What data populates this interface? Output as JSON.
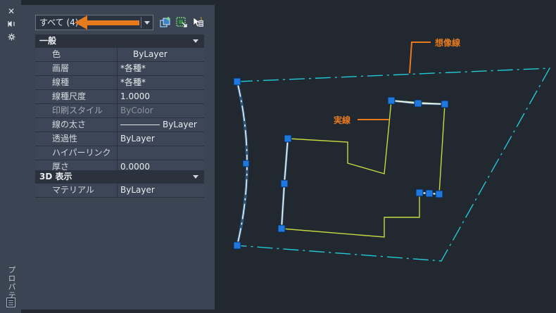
{
  "sidebar": {
    "close_icon": "close-icon",
    "pin_icon": "pin-icon",
    "settings_icon": "gear-icon",
    "vertical_title": "プロパティ",
    "bottom_icon": "properties-icon"
  },
  "selector": {
    "value": "すべて (4)",
    "toolbar_icons": [
      "quick-select-icon",
      "select-objects-icon",
      "toggle-pickadd-icon"
    ]
  },
  "sections": {
    "general": {
      "title": "一般",
      "rows": [
        {
          "label": "色",
          "value": "ByLayer",
          "has_swatch": true
        },
        {
          "label": "画層",
          "value": "*各種*"
        },
        {
          "label": "線種",
          "value": "*各種*"
        },
        {
          "label": "線種尺度",
          "value": "1.0000"
        },
        {
          "label": "印刷スタイル",
          "value": "ByColor",
          "disabled": true
        },
        {
          "label": "線の太さ",
          "value": "ByLayer",
          "has_line": true
        },
        {
          "label": "透過性",
          "value": "ByLayer"
        },
        {
          "label": "ハイパーリンク",
          "value": ""
        },
        {
          "label": "厚さ",
          "value": "0.0000"
        }
      ]
    },
    "view3d": {
      "title": "3D 表示",
      "rows": [
        {
          "label": "マテリアル",
          "value": "ByLayer"
        }
      ]
    }
  },
  "canvas": {
    "callout_hidden": "想像線",
    "callout_solid": "実線"
  },
  "colors": {
    "accent": "#e87a1e",
    "cyan": "#22c9d6",
    "yellow_green": "#c7d940",
    "grip_blue": "#1f78e0",
    "background": "#212830",
    "panel": "#3b4453"
  }
}
